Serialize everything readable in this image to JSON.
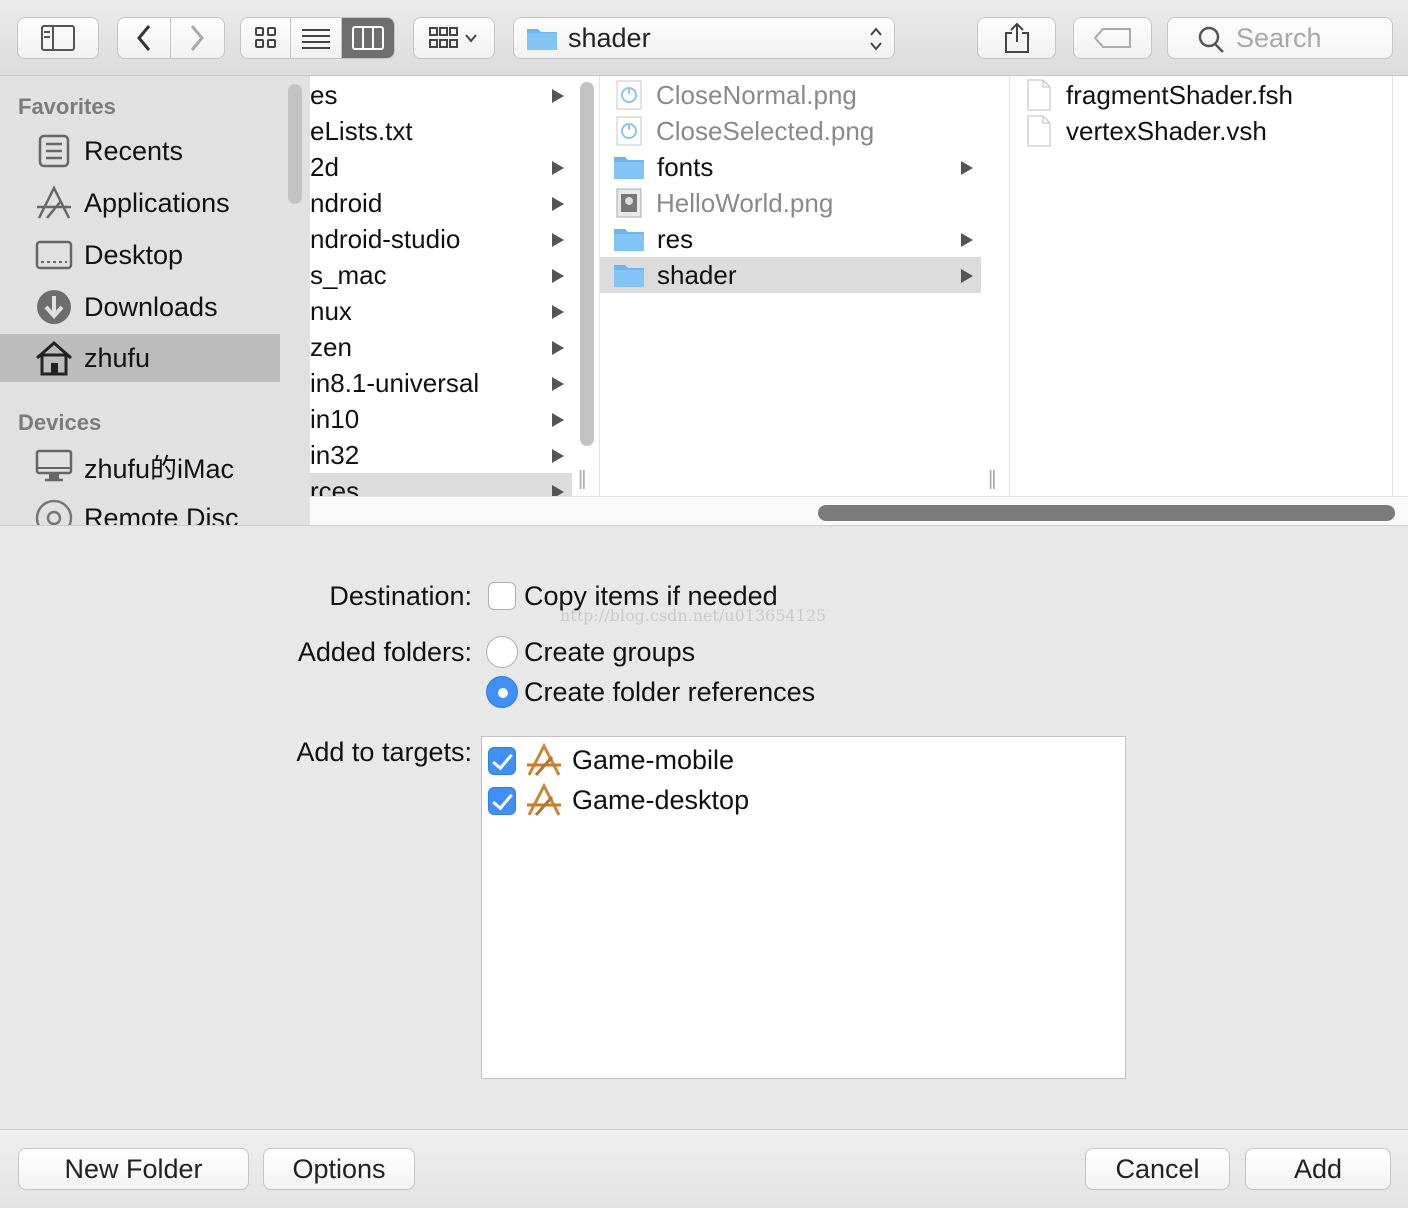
{
  "toolbar": {
    "path_folder": "shader",
    "search_placeholder": "Search"
  },
  "sidebar": {
    "favorites_header": "Favorites",
    "favorites": [
      {
        "label": "Recents",
        "icon": "recents-icon"
      },
      {
        "label": "Applications",
        "icon": "applications-icon"
      },
      {
        "label": "Desktop",
        "icon": "desktop-icon"
      },
      {
        "label": "Downloads",
        "icon": "downloads-icon"
      },
      {
        "label": "zhufu",
        "icon": "home-icon"
      }
    ],
    "devices_header": "Devices",
    "devices": [
      {
        "label": "zhufu的iMac",
        "icon": "imac-icon"
      },
      {
        "label": "Remote Disc",
        "icon": "disc-icon"
      }
    ]
  },
  "columns": {
    "col1": [
      {
        "name": "es"
      },
      {
        "name": "eLists.txt"
      },
      {
        "name": "2d"
      },
      {
        "name": "ndroid"
      },
      {
        "name": "ndroid-studio"
      },
      {
        "name": "s_mac"
      },
      {
        "name": "nux"
      },
      {
        "name": "zen"
      },
      {
        "name": "in8.1-universal"
      },
      {
        "name": "in10"
      },
      {
        "name": "in32"
      },
      {
        "name": "rces"
      }
    ],
    "col2": [
      {
        "name": "CloseNormal.png"
      },
      {
        "name": "CloseSelected.png"
      },
      {
        "name": "fonts"
      },
      {
        "name": "HelloWorld.png"
      },
      {
        "name": "res"
      },
      {
        "name": "shader"
      }
    ],
    "col3": [
      {
        "name": "fragmentShader.fsh"
      },
      {
        "name": "vertexShader.vsh"
      }
    ]
  },
  "options": {
    "destination_label": "Destination:",
    "copy_items": "Copy items if needed",
    "added_folders_label": "Added folders:",
    "create_groups": "Create groups",
    "create_folder_refs": "Create folder references",
    "add_to_targets_label": "Add to targets:",
    "targets": [
      {
        "name": "Game-mobile",
        "checked": true
      },
      {
        "name": "Game-desktop",
        "checked": true
      }
    ],
    "watermark": "http://blog.csdn.net/u013654125"
  },
  "buttons": {
    "new_folder": "New Folder",
    "options": "Options",
    "cancel": "Cancel",
    "add": "Add"
  },
  "colors": {
    "accent": "#3f8ff6",
    "folder": "#6bb6f2"
  }
}
